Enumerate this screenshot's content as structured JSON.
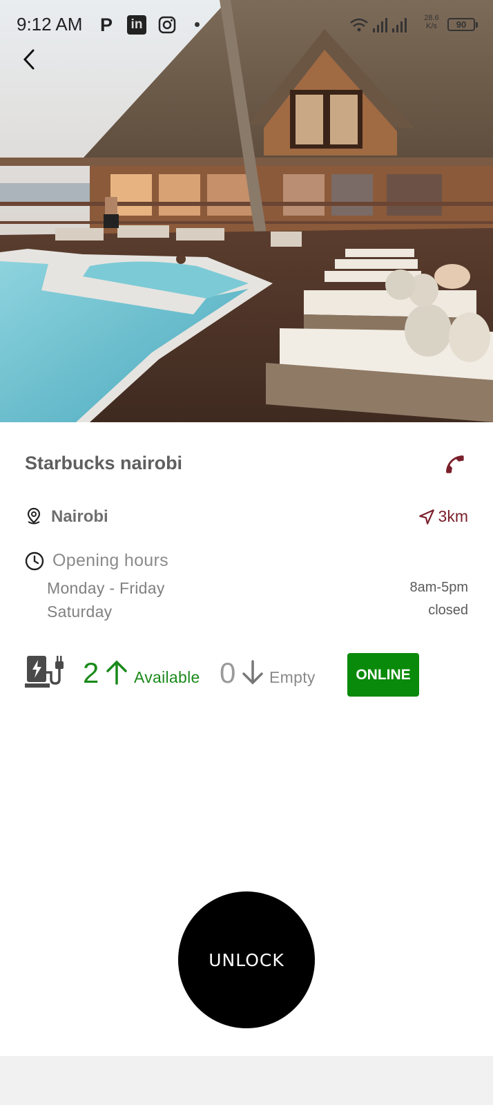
{
  "status_bar": {
    "time": "9:12 AM",
    "app_icons": [
      "p-icon",
      "linkedin-icon",
      "instagram-icon"
    ],
    "network_speed": "28.6",
    "network_speed_unit": "K/s",
    "battery": "90"
  },
  "navigation": {
    "back_icon": "chevron-left-icon"
  },
  "place": {
    "name": "Starbucks nairobi",
    "location": "Nairobi",
    "distance": "3km",
    "accent_color": "#7a1f2b"
  },
  "hours": {
    "title": "Opening hours",
    "rows": [
      {
        "day": "Monday - Friday",
        "time": "8am-5pm"
      },
      {
        "day": "Saturday",
        "time": "closed"
      }
    ]
  },
  "availability": {
    "available_count": "2",
    "available_label": "Available",
    "available_color": "#1a8a1a",
    "empty_count": "0",
    "empty_label": "Empty",
    "status": "ONLINE",
    "status_color": "#0a8a0a"
  },
  "actions": {
    "unlock_label": "UNLOCK"
  }
}
